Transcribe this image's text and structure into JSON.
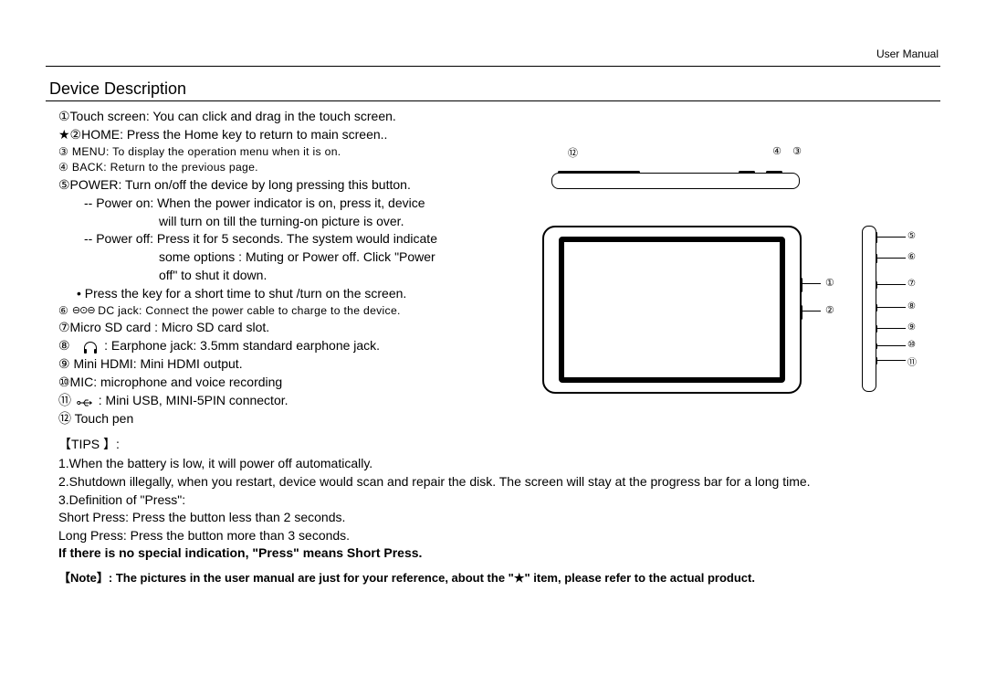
{
  "header": {
    "right": "User Manual"
  },
  "section_title": "Device Description",
  "desc": {
    "l1": "①Touch screen: You can click and drag in the touch screen.",
    "l2": "★②HOME: Press the Home key to return to main screen..",
    "l3": "③ MENU: To display the operation menu when it is on.",
    "l4": "④ BACK: Return to the previous page.",
    "l5": "⑤POWER: Turn on/off the device by long pressing this button.",
    "l5a": "-- Power on: When the power indicator is on, press it, device",
    "l5b": "will turn on till the turning-on picture is over.",
    "l5c": "-- Power off: Press it for 5 seconds. The system would indicate",
    "l5d": "some options : Muting or Power off. Click \"Power",
    "l5e": "off\" to shut it down.",
    "l5f": "Press the key for a short time to shut /turn on the screen.",
    "l6a": "⑥",
    "l6b": "DC jack: Connect the power cable to charge to the device.",
    "l7": "⑦Micro SD card : Micro SD card slot.",
    "l8a": "⑧",
    "l8b": ": Earphone jack: 3.5mm standard earphone jack.",
    "l9": "⑨ Mini HDMI: Mini HDMI output.",
    "l10": "⑩MIC: microphone and voice recording",
    "l11a": "⑪",
    "l11b": ": Mini USB, MINI-5PIN connector.",
    "l12": "⑫ Touch pen"
  },
  "tips": {
    "title": "【TIPS 】:",
    "t1": "1.When the battery is low, it will power off automatically.",
    "t2": "2.Shutdown illegally, when you restart, device would scan and repair the disk. The screen will stay at the progress bar for a long time.",
    "t3": "3.Definition of \"Press\":",
    "t4": "Short Press: Press the button less than 2 seconds.",
    "t5": "Long Press: Press the button more than 3 seconds.",
    "bold": "If there is no special indication, \"Press\" means Short Press."
  },
  "note": "【Note】:  The pictures in the user manual are just for your reference, about the \"★\" item, please refer to the actual product.",
  "callouts": {
    "c1": "①",
    "c2": "②",
    "c3": "③",
    "c4": "④",
    "c5": "⑤",
    "c6": "⑥",
    "c7": "⑦",
    "c8": "⑧",
    "c9": "⑨",
    "c10": "⑩",
    "c11": "⑪",
    "c12": "⑫"
  }
}
